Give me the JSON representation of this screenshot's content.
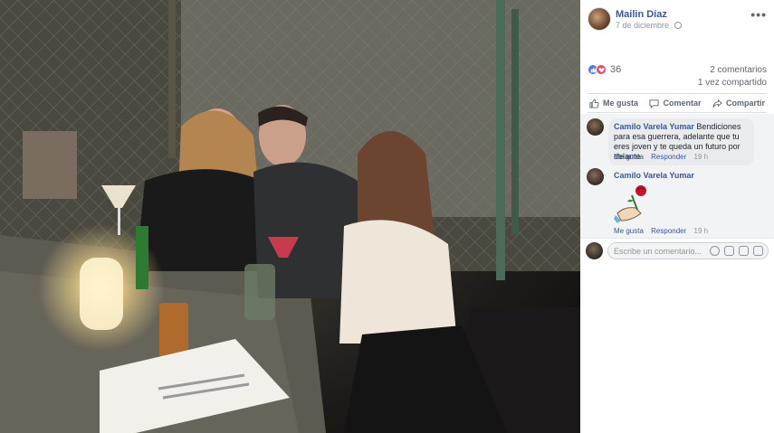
{
  "post": {
    "author": "Mailin Díaz",
    "date": "7 de diciembre",
    "more_icon": "more-icon"
  },
  "stats": {
    "reaction_count": "36",
    "comments": "2 comentarios",
    "shares": "1 vez compartido"
  },
  "actions": {
    "like": "Me gusta",
    "comment": "Comentar",
    "share": "Compartir"
  },
  "comments": [
    {
      "author": "Camilo Varela Yumar",
      "text": "Bendiciones para esa guerrera, adelante que tu eres joven y te queda un futuro por delante",
      "like": "Me gusta",
      "reply": "Responder",
      "time": "19 h"
    },
    {
      "author": "Camilo Varela Yumar",
      "sticker": "rose-sticker",
      "like": "Me gusta",
      "reply": "Responder",
      "time": "19 h"
    }
  ],
  "composer": {
    "placeholder": "Escribe un comentario..."
  },
  "colors": {
    "link": "#385898",
    "muted": "#90949c",
    "like_blue": "#4a7bd6",
    "love_red": "#e9475e"
  }
}
